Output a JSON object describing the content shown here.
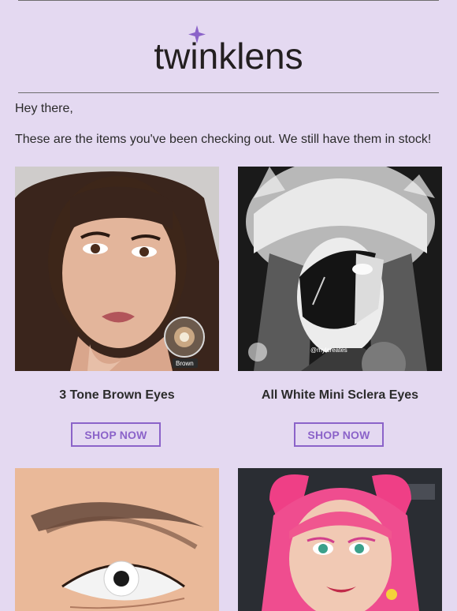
{
  "brand": {
    "name": "twinklens",
    "accent": "#8b63c9",
    "background": "#e4d9f1"
  },
  "email": {
    "greeting": "Hey there,",
    "intro": "These are the items you've been checking out. We still have them in stock!"
  },
  "products": [
    {
      "name": "3 Tone Brown Eyes",
      "button": "SHOP NOW",
      "image_label": "Brown"
    },
    {
      "name": "All White Mini Sclera Eyes",
      "button": "SHOP NOW",
      "watermark": "@mylcreates"
    },
    {
      "name": "",
      "button": ""
    },
    {
      "name": "",
      "button": ""
    }
  ]
}
